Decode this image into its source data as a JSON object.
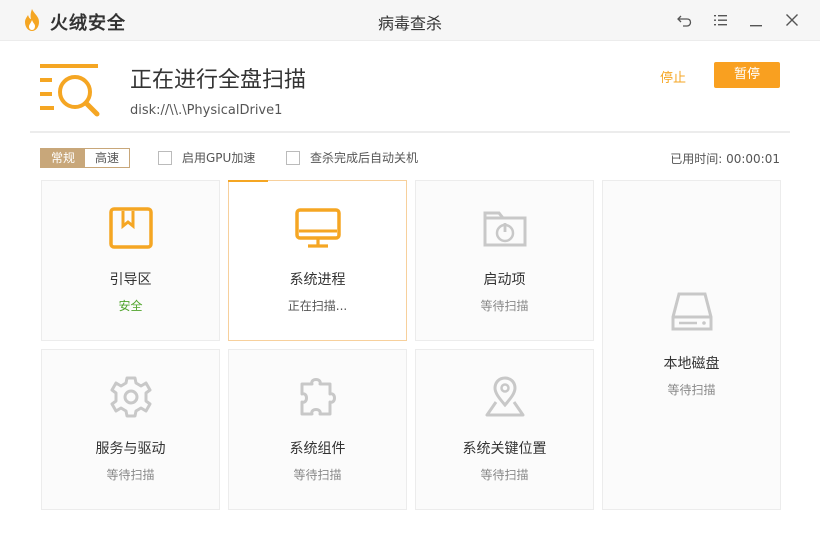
{
  "app": {
    "brand": "火绒安全",
    "title": "病毒查杀"
  },
  "header": {
    "title": "正在进行全盘扫描",
    "path": "disk://\\\\.\\PhysicalDrive1",
    "stop_label": "停止",
    "pause_label": "暂停"
  },
  "options": {
    "mode_normal": "常规",
    "mode_fast": "高速",
    "gpu_label": "启用GPU加速",
    "shutdown_label": "查杀完成后自动关机",
    "elapsed_label": "已用时间:",
    "elapsed_value": "00:00:01"
  },
  "colors": {
    "accent": "#f5a623",
    "safe": "#52a52e",
    "icon_idle": "#c8c8c8"
  },
  "cards": [
    {
      "name": "引导区",
      "status": "安全",
      "icon": "boot-sector-icon"
    },
    {
      "name": "系统进程",
      "status": "正在扫描...",
      "icon": "monitor-icon"
    },
    {
      "name": "启动项",
      "status": "等待扫描",
      "icon": "startup-folder-icon"
    },
    {
      "name": "本地磁盘",
      "status": "等待扫描",
      "icon": "hard-disk-icon"
    },
    {
      "name": "服务与驱动",
      "status": "等待扫描",
      "icon": "gear-icon"
    },
    {
      "name": "系统组件",
      "status": "等待扫描",
      "icon": "puzzle-icon"
    },
    {
      "name": "系统关键位置",
      "status": "等待扫描",
      "icon": "location-pin-icon"
    }
  ]
}
